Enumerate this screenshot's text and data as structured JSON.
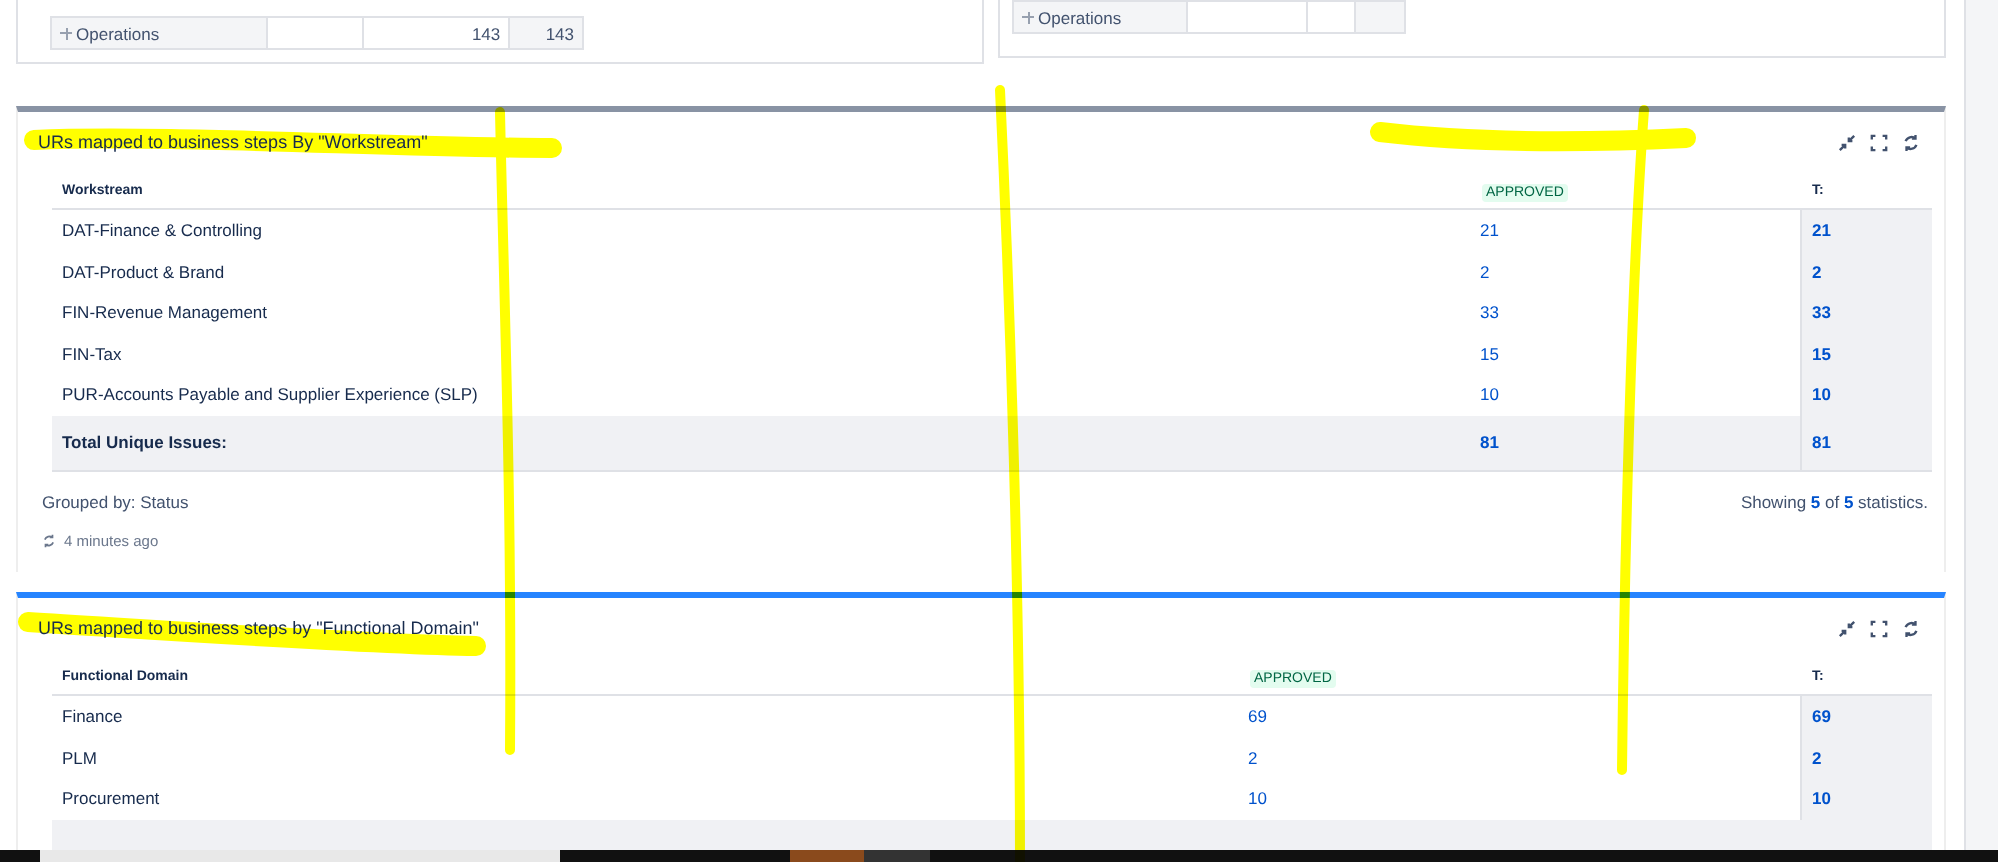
{
  "top_panels": [
    {
      "rows": [
        {
          "label": "Operations",
          "column_3": "143",
          "column_4": "143"
        }
      ]
    },
    {
      "rows": [
        {
          "label": "Operations"
        }
      ]
    }
  ],
  "gadgets": [
    {
      "title": "URs mapped to business steps By \"Workstream\"",
      "selected": false,
      "columns": [
        "Workstream",
        "APPROVED",
        "T:"
      ],
      "rows": [
        {
          "name": "DAT-Finance & Controlling",
          "approved": "21",
          "total": "21"
        },
        {
          "name": "DAT-Product & Brand",
          "approved": "2",
          "total": "2"
        },
        {
          "name": "FIN-Revenue Management",
          "approved": "33",
          "total": "33"
        },
        {
          "name": "FIN-Tax",
          "approved": "15",
          "total": "15"
        },
        {
          "name": "PUR-Accounts Payable and Supplier Experience (SLP)",
          "approved": "10",
          "total": "10"
        }
      ],
      "total": {
        "label": "Total Unique Issues:",
        "approved": "81",
        "total": "81"
      },
      "grouped_by": "Grouped by: Status",
      "showing": "Showing **5** of **5** statistics.",
      "updated": "4 minutes ago"
    },
    {
      "title": "URs mapped to business steps by \"Functional Domain\"",
      "selected": true,
      "columns": [
        "Functional Domain",
        "APPROVED",
        "T:"
      ],
      "rows": [
        {
          "name": "Finance",
          "approved": "69",
          "total": "69"
        },
        {
          "name": "PLM",
          "approved": "2",
          "total": "2"
        },
        {
          "name": "Procurement",
          "approved": "10",
          "total": "10"
        }
      ]
    }
  ],
  "highlighter_marks": true
}
